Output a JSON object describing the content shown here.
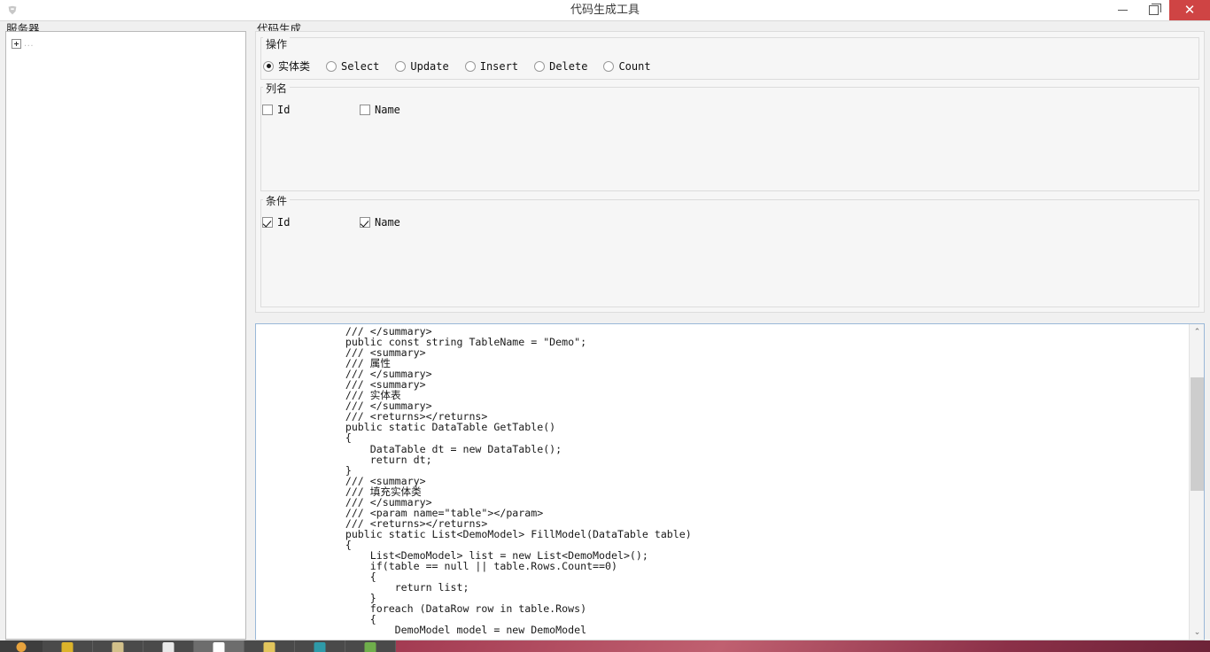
{
  "window": {
    "title": "代码生成工具",
    "icon": "app-icon",
    "controls": {
      "minimize": "—",
      "maximize": "❐",
      "close": "✕"
    },
    "close_color": "#cf4444"
  },
  "sidebar": {
    "caption": "服务器",
    "tree": [
      {
        "expander": "plus-icon",
        "label": "..."
      }
    ]
  },
  "codegen": {
    "caption": "代码生成",
    "operation": {
      "caption": "操作",
      "options": [
        {
          "label": "实体类",
          "checked": true,
          "cjk": true
        },
        {
          "label": "Select",
          "checked": false,
          "cjk": false
        },
        {
          "label": "Update",
          "checked": false,
          "cjk": false
        },
        {
          "label": "Insert",
          "checked": false,
          "cjk": false
        },
        {
          "label": "Delete",
          "checked": false,
          "cjk": false
        },
        {
          "label": "Count",
          "checked": false,
          "cjk": false
        }
      ]
    },
    "columns": {
      "caption": "列名",
      "items": [
        {
          "label": "Id",
          "checked": false
        },
        {
          "label": "Name",
          "checked": false
        }
      ]
    },
    "conditions": {
      "caption": "条件",
      "items": [
        {
          "label": "Id",
          "checked": true
        },
        {
          "label": "Name",
          "checked": true
        }
      ]
    }
  },
  "code_output": {
    "scrollbar": {
      "up": "⌃",
      "down": "⌄"
    },
    "text": "        /// </summary>\n        public const string TableName = \"Demo\";\n        /// <summary>\n        /// 属性\n        /// </summary>\n        /// <summary>\n        /// 实体表\n        /// </summary>\n        /// <returns></returns>\n        public static DataTable GetTable()\n        {\n            DataTable dt = new DataTable();\n            return dt;\n        }\n        /// <summary>\n        /// 填充实体类\n        /// </summary>\n        /// <param name=\"table\"></param>\n        /// <returns></returns>\n        public static List<DemoModel> FillModel(DataTable table)\n        {\n            List<DemoModel> list = new List<DemoModel>();\n            if(table == null || table.Rows.Count==0)\n            {\n                return list;\n            }\n            foreach (DataRow row in table.Rows)\n            {\n                DemoModel model = new DemoModel"
  },
  "taskbar": {
    "start": "start-orb-icon",
    "items": [
      "taskbar-item-1",
      "taskbar-item-2",
      "taskbar-item-3",
      "taskbar-item-4",
      "taskbar-item-5",
      "taskbar-item-6",
      "taskbar-item-7"
    ]
  }
}
